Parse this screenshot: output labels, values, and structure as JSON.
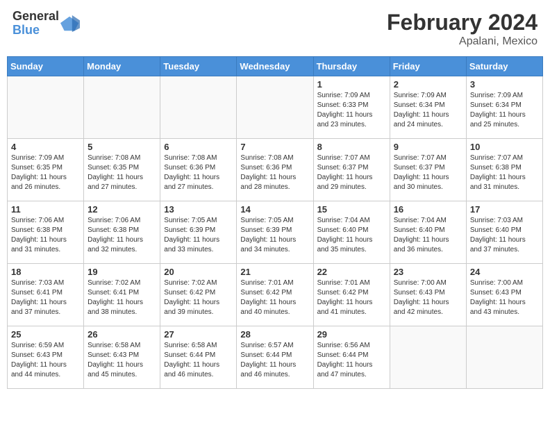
{
  "header": {
    "logo_line1": "General",
    "logo_line2": "Blue",
    "title": "February 2024",
    "subtitle": "Apalani, Mexico"
  },
  "days_of_week": [
    "Sunday",
    "Monday",
    "Tuesday",
    "Wednesday",
    "Thursday",
    "Friday",
    "Saturday"
  ],
  "weeks": [
    [
      {
        "day": "",
        "info": ""
      },
      {
        "day": "",
        "info": ""
      },
      {
        "day": "",
        "info": ""
      },
      {
        "day": "",
        "info": ""
      },
      {
        "day": "1",
        "info": "Sunrise: 7:09 AM\nSunset: 6:33 PM\nDaylight: 11 hours and 23 minutes."
      },
      {
        "day": "2",
        "info": "Sunrise: 7:09 AM\nSunset: 6:34 PM\nDaylight: 11 hours and 24 minutes."
      },
      {
        "day": "3",
        "info": "Sunrise: 7:09 AM\nSunset: 6:34 PM\nDaylight: 11 hours and 25 minutes."
      }
    ],
    [
      {
        "day": "4",
        "info": "Sunrise: 7:09 AM\nSunset: 6:35 PM\nDaylight: 11 hours and 26 minutes."
      },
      {
        "day": "5",
        "info": "Sunrise: 7:08 AM\nSunset: 6:35 PM\nDaylight: 11 hours and 27 minutes."
      },
      {
        "day": "6",
        "info": "Sunrise: 7:08 AM\nSunset: 6:36 PM\nDaylight: 11 hours and 27 minutes."
      },
      {
        "day": "7",
        "info": "Sunrise: 7:08 AM\nSunset: 6:36 PM\nDaylight: 11 hours and 28 minutes."
      },
      {
        "day": "8",
        "info": "Sunrise: 7:07 AM\nSunset: 6:37 PM\nDaylight: 11 hours and 29 minutes."
      },
      {
        "day": "9",
        "info": "Sunrise: 7:07 AM\nSunset: 6:37 PM\nDaylight: 11 hours and 30 minutes."
      },
      {
        "day": "10",
        "info": "Sunrise: 7:07 AM\nSunset: 6:38 PM\nDaylight: 11 hours and 31 minutes."
      }
    ],
    [
      {
        "day": "11",
        "info": "Sunrise: 7:06 AM\nSunset: 6:38 PM\nDaylight: 11 hours and 31 minutes."
      },
      {
        "day": "12",
        "info": "Sunrise: 7:06 AM\nSunset: 6:38 PM\nDaylight: 11 hours and 32 minutes."
      },
      {
        "day": "13",
        "info": "Sunrise: 7:05 AM\nSunset: 6:39 PM\nDaylight: 11 hours and 33 minutes."
      },
      {
        "day": "14",
        "info": "Sunrise: 7:05 AM\nSunset: 6:39 PM\nDaylight: 11 hours and 34 minutes."
      },
      {
        "day": "15",
        "info": "Sunrise: 7:04 AM\nSunset: 6:40 PM\nDaylight: 11 hours and 35 minutes."
      },
      {
        "day": "16",
        "info": "Sunrise: 7:04 AM\nSunset: 6:40 PM\nDaylight: 11 hours and 36 minutes."
      },
      {
        "day": "17",
        "info": "Sunrise: 7:03 AM\nSunset: 6:40 PM\nDaylight: 11 hours and 37 minutes."
      }
    ],
    [
      {
        "day": "18",
        "info": "Sunrise: 7:03 AM\nSunset: 6:41 PM\nDaylight: 11 hours and 37 minutes."
      },
      {
        "day": "19",
        "info": "Sunrise: 7:02 AM\nSunset: 6:41 PM\nDaylight: 11 hours and 38 minutes."
      },
      {
        "day": "20",
        "info": "Sunrise: 7:02 AM\nSunset: 6:42 PM\nDaylight: 11 hours and 39 minutes."
      },
      {
        "day": "21",
        "info": "Sunrise: 7:01 AM\nSunset: 6:42 PM\nDaylight: 11 hours and 40 minutes."
      },
      {
        "day": "22",
        "info": "Sunrise: 7:01 AM\nSunset: 6:42 PM\nDaylight: 11 hours and 41 minutes."
      },
      {
        "day": "23",
        "info": "Sunrise: 7:00 AM\nSunset: 6:43 PM\nDaylight: 11 hours and 42 minutes."
      },
      {
        "day": "24",
        "info": "Sunrise: 7:00 AM\nSunset: 6:43 PM\nDaylight: 11 hours and 43 minutes."
      }
    ],
    [
      {
        "day": "25",
        "info": "Sunrise: 6:59 AM\nSunset: 6:43 PM\nDaylight: 11 hours and 44 minutes."
      },
      {
        "day": "26",
        "info": "Sunrise: 6:58 AM\nSunset: 6:43 PM\nDaylight: 11 hours and 45 minutes."
      },
      {
        "day": "27",
        "info": "Sunrise: 6:58 AM\nSunset: 6:44 PM\nDaylight: 11 hours and 46 minutes."
      },
      {
        "day": "28",
        "info": "Sunrise: 6:57 AM\nSunset: 6:44 PM\nDaylight: 11 hours and 46 minutes."
      },
      {
        "day": "29",
        "info": "Sunrise: 6:56 AM\nSunset: 6:44 PM\nDaylight: 11 hours and 47 minutes."
      },
      {
        "day": "",
        "info": ""
      },
      {
        "day": "",
        "info": ""
      }
    ]
  ]
}
